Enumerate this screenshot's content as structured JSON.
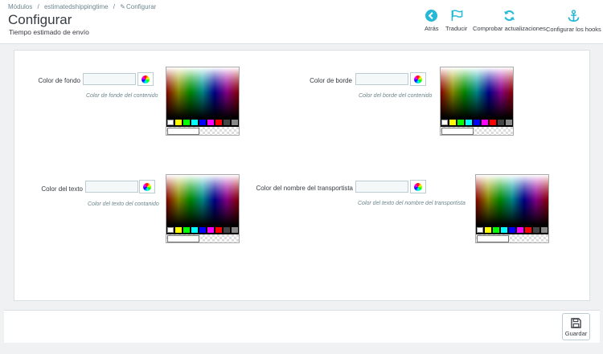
{
  "breadcrumb": {
    "item1": "Módulos",
    "sep1": "/",
    "item2": "estimatedshippingtime",
    "sep2": "/",
    "item3": "Configurar"
  },
  "page": {
    "title": "Configurar",
    "subtitle": "Tiempo estimado de envío"
  },
  "toolbar": {
    "back": "Atrás",
    "translate": "Traducir",
    "check_updates": "Comprobar actualizaciones",
    "hooks": "Configurar los hooks"
  },
  "fields": {
    "background": {
      "label": "Color de fondo",
      "value": "",
      "help": "Color de fonde del contenido"
    },
    "border": {
      "label": "Color de borde",
      "value": "",
      "help": "Color del borde del contenido"
    },
    "text": {
      "label": "Color del texto",
      "value": "",
      "help": "Color del texto del contanido"
    },
    "carrier": {
      "label": "Color del nombre del transportista",
      "value": "",
      "help": "Color del texto del nombre del transportista"
    }
  },
  "swatch_colors": [
    "#ffffff",
    "#ffff00",
    "#00ff00",
    "#00ffff",
    "#0000ff",
    "#ff00ff",
    "#ff0000",
    "#444444",
    "#888888"
  ],
  "colors": {
    "accent": "#25b9d7",
    "text": "#363a41",
    "muted": "#6c868e",
    "border": "#bbcdd2"
  },
  "footer": {
    "save": "Guardar"
  }
}
